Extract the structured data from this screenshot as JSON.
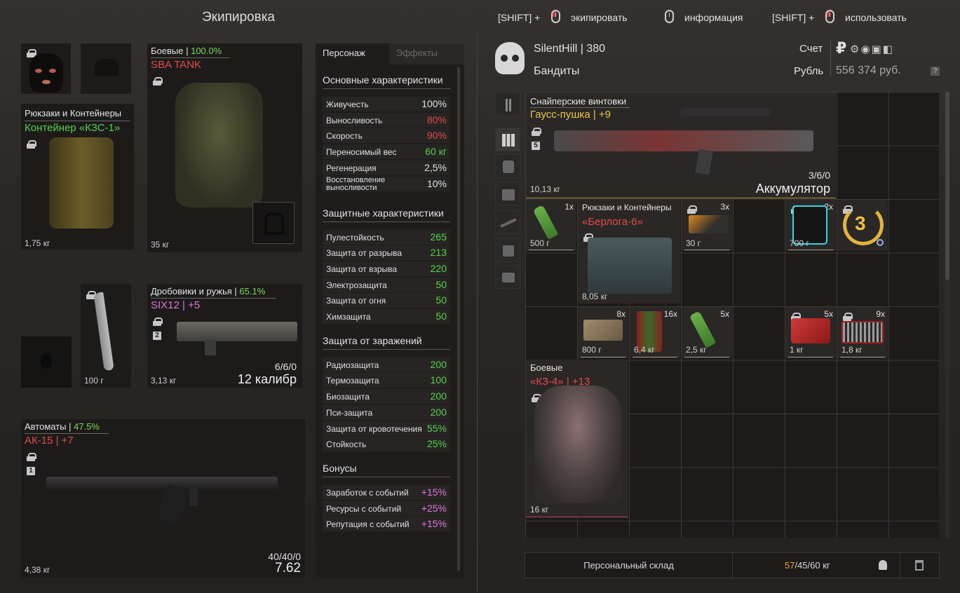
{
  "header": {
    "title": "Экипировка",
    "hint_equip_key": "[SHIFT] +",
    "hint_equip": "экипировать",
    "hint_info": "информация",
    "hint_use_key": "[SHIFT] +",
    "hint_use": "использовать"
  },
  "equipment": {
    "backpack": {
      "category": "Рюкзаки и Контейнеры",
      "name": "Контейнер «КЗС-1»",
      "weight": "1,75 кг"
    },
    "armor": {
      "category": "Боевые",
      "pct": "100.0%",
      "name": "SBA TANK",
      "weight": "35 кг"
    },
    "shotgun": {
      "category": "Дробовики и ружья",
      "pct": "65.1%",
      "name": "SIX12 | +5",
      "slot": "2",
      "weight": "3,13 кг",
      "ammo": "6/6/0",
      "caliber": "12 калибр"
    },
    "knife": {
      "weight": "100 г"
    },
    "rifle": {
      "category": "Автоматы",
      "pct": "47.5%",
      "name": "АК-15 | +7",
      "slot": "1",
      "weight": "4,38 кг",
      "ammo": "40/40/0",
      "caliber": "7.62"
    }
  },
  "stats": {
    "tabs": [
      "Персонаж",
      "Эффекты"
    ],
    "sections": [
      {
        "title": "Основные характеристики",
        "rows": [
          [
            "Живучесть",
            "100%",
            "white"
          ],
          [
            "Выносливость",
            "80%",
            "red"
          ],
          [
            "Скорость",
            "90%",
            "red"
          ],
          [
            "Переносимый вес",
            "60 кг",
            "green"
          ],
          [
            "Регенерация",
            "2,5%",
            "white"
          ],
          [
            "Восстановление выносливости",
            "10%",
            "white"
          ]
        ]
      },
      {
        "title": "Защитные характеристики",
        "rows": [
          [
            "Пулестойкость",
            "265",
            "green"
          ],
          [
            "Защита от разрыва",
            "213",
            "green"
          ],
          [
            "Защита от взрыва",
            "220",
            "green"
          ],
          [
            "Электрозащита",
            "50",
            "green"
          ],
          [
            "Защита от огня",
            "50",
            "green"
          ],
          [
            "Химзащита",
            "50",
            "green"
          ]
        ]
      },
      {
        "title": "Защита от заражений",
        "rows": [
          [
            "Радиозащита",
            "200",
            "green"
          ],
          [
            "Термозащита",
            "100",
            "green"
          ],
          [
            "Биозащита",
            "200",
            "green"
          ],
          [
            "Пси-защита",
            "200",
            "green"
          ],
          [
            "Защита от кровотечения",
            "55%",
            "green"
          ],
          [
            "Стойкость",
            "25%",
            "green"
          ]
        ]
      },
      {
        "title": "Бонусы",
        "rows": [
          [
            "Заработок с событий",
            "+15%",
            "pink"
          ],
          [
            "Ресурсы с событий",
            "+25%",
            "pink"
          ],
          [
            "Репутация с событий",
            "+15%",
            "pink"
          ]
        ]
      }
    ]
  },
  "player": {
    "name": "SilentHill | 380",
    "faction": "Бандиты",
    "account_label": "Счет",
    "currency_label": "Рубль",
    "money": "556 374 руб.",
    "help": "?"
  },
  "inventory": {
    "rifle": {
      "category": "Снайперские винтовки",
      "name": "Гаусс-пушка | +9",
      "slot": "5",
      "weight": "10,13 кг",
      "ammo": "3/6/0",
      "ammo_type": "Аккумулятор"
    },
    "backpack": {
      "category": "Рюкзаки и Контейнеры",
      "name": "«Берлога-6»",
      "weight": "8,05 кг"
    },
    "armor": {
      "category": "Боевые",
      "name": "«КЗ-4» | +13",
      "weight": "16 кг"
    },
    "items": [
      {
        "count": "1x",
        "weight": "500 г"
      },
      {
        "count": "3x",
        "weight": "30 г"
      },
      {
        "count": "2x",
        "weight": "700 г"
      },
      {
        "count": "",
        "weight": "",
        "badge": "3"
      },
      {
        "count": "8x",
        "weight": "800 г"
      },
      {
        "count": "16x",
        "weight": "6,4 кг"
      },
      {
        "count": "5x",
        "weight": "2,5 кг"
      },
      {
        "count": "5x",
        "weight": "1 кг"
      },
      {
        "count": "9x",
        "weight": "1,8 кг"
      }
    ]
  },
  "footer": {
    "storage": "Персональный склад",
    "weight_current": "57",
    "weight_rest": "/45/60 кг"
  },
  "colors": {
    "red": "#e6494b",
    "green": "#58d04b",
    "pink": "#e075d8",
    "gold": "#e9c544",
    "orange": "#f0a030"
  }
}
